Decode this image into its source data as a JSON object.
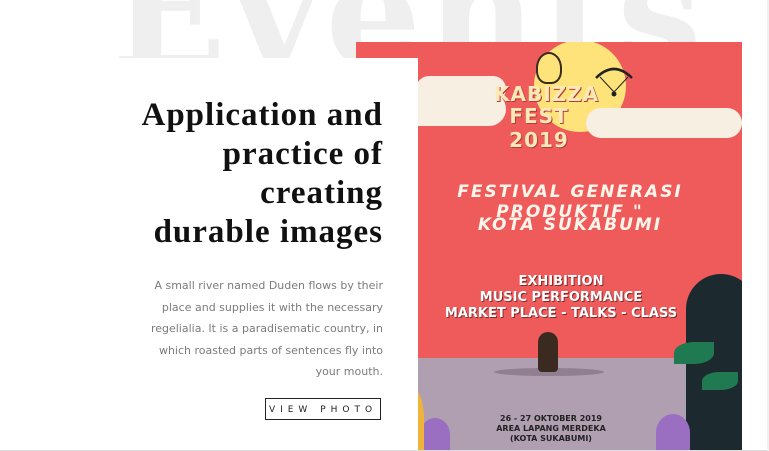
{
  "background_word": "Events",
  "article": {
    "heading_lines": [
      "Application and",
      "practice of",
      "creating",
      "durable images"
    ],
    "description_lines": [
      "A small river named Duden flows by their",
      "place and supplies it with the necessary",
      "regelialia. It is a paradisematic country, in",
      "which roasted parts of sentences fly into",
      "your mouth."
    ],
    "button_label": "VIEW PHOTO"
  },
  "poster": {
    "logo_line1": "KABIZZA",
    "logo_line2": "FEST 2019",
    "festival_line": "FESTIVAL GENERASI PRODUKTIF \"",
    "city_line": "KOTA SUKABUMI",
    "program": [
      "EXHIBITION",
      "MUSIC PERFORMANCE",
      "MARKET PLACE - TALKS - CLASS"
    ],
    "date_lines": [
      "26 - 27 OKTOBER 2019",
      "AREA LAPANG MERDEKA",
      "(KOTA SUKABUMI)"
    ]
  },
  "colors": {
    "poster_red": "#ef5b5b",
    "sun_yellow": "#fde37a",
    "ground_lilac": "#b09fb0",
    "heading": "#111111",
    "body_text": "#7b7b7b"
  }
}
